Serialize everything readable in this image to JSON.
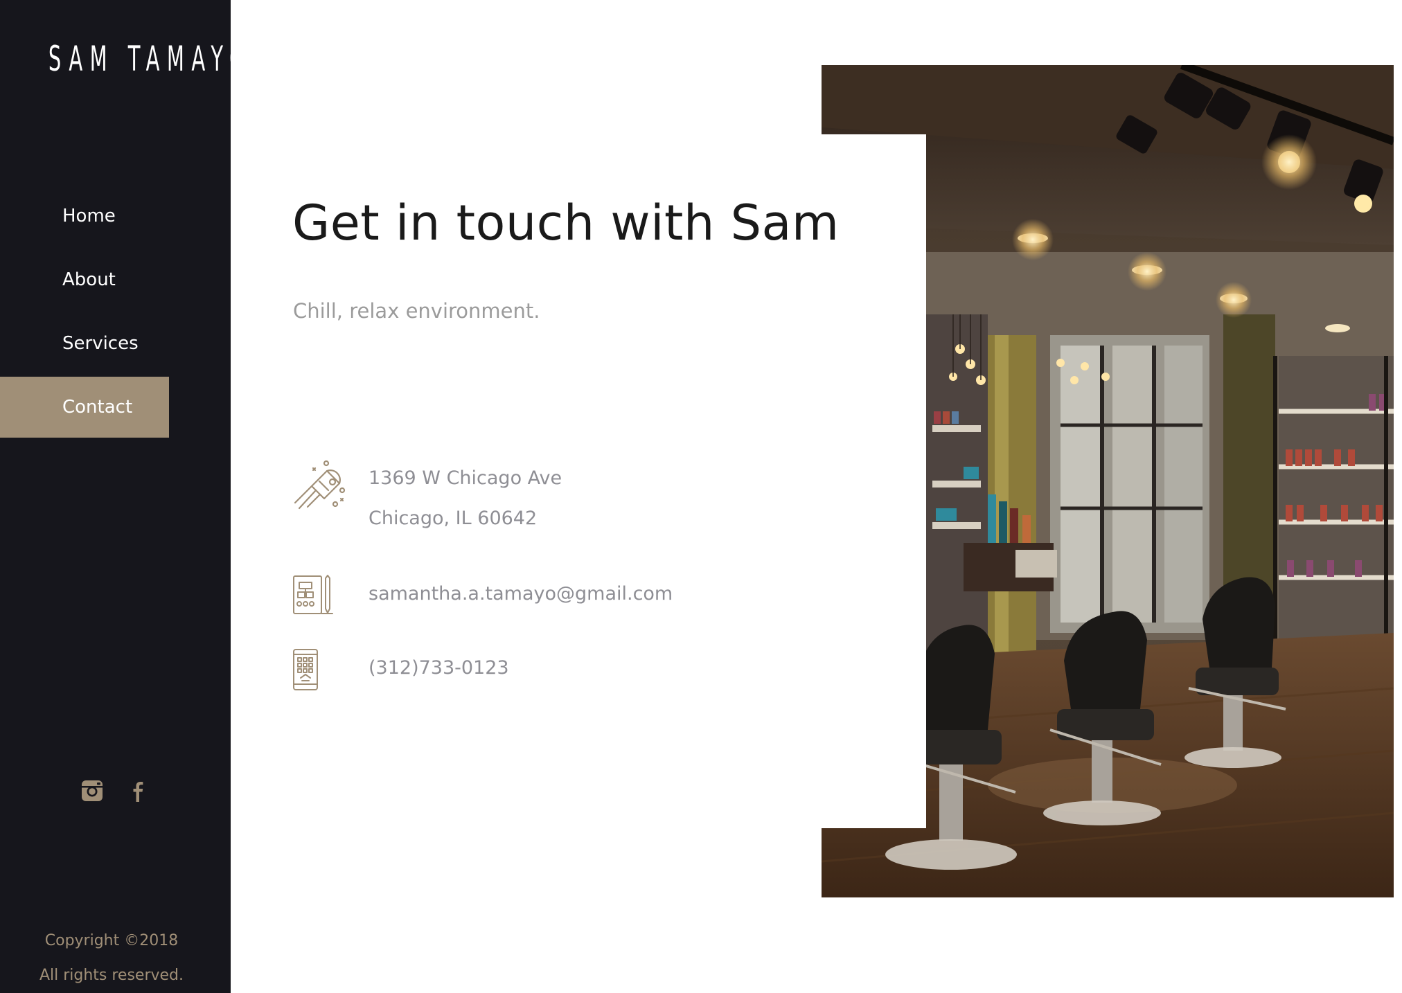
{
  "brand": {
    "logo_text": "SAM TAMAYO"
  },
  "nav": {
    "items": [
      {
        "label": "Home",
        "active": false
      },
      {
        "label": "About",
        "active": false
      },
      {
        "label": "Services",
        "active": false
      },
      {
        "label": "Contact",
        "active": true
      }
    ]
  },
  "social": {
    "icons": [
      "instagram-icon",
      "facebook-icon"
    ]
  },
  "footer": {
    "copyright_line1": "Copyright ©2018",
    "copyright_line2": "All rights reserved."
  },
  "contact": {
    "heading": "Get in touch with Sam",
    "subheading": "Chill, relax environment.",
    "address_line1": "1369 W Chicago Ave",
    "address_line2": "Chicago, IL 60642",
    "email": "samantha.a.tamayo@gmail.com",
    "phone": "(312)733-0123",
    "icons": [
      "location-rocket-icon",
      "email-app-icon",
      "phone-keypad-icon"
    ]
  },
  "colors": {
    "sidebar_bg": "#16161c",
    "accent": "#a08f77",
    "heading_text": "#1a1a1a",
    "muted_text": "#8e8e94",
    "background": "#ffffff"
  }
}
